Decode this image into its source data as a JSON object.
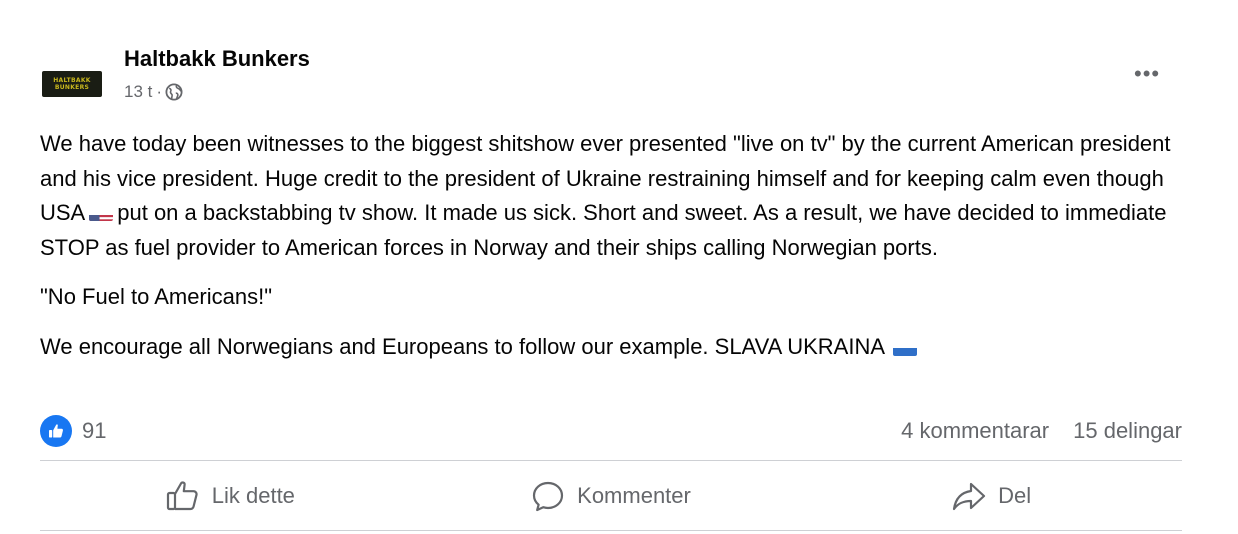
{
  "post": {
    "page_name": "Haltbakk Bunkers",
    "logo_text_line1": "HALTBAKK",
    "logo_text_line2": "BUNKERS",
    "timestamp": "13 t",
    "separator": "·",
    "privacy_icon": "globe-icon",
    "more_label": "•••",
    "body": {
      "p1_part1": "We have today been witnesses to the biggest shitshow ever presented \"live on tv\" by the current American president and his vice president. Huge credit to the president of Ukraine restraining himself and for keeping calm even though USA",
      "p1_flag": "us-flag-emoji",
      "p1_part2": "put on a backstabbing tv show. It made us sick. Short and sweet. As a result, we have decided to immediate STOP as fuel provider to American forces in Norway and their ships calling Norwegian ports.",
      "p2": "\"No Fuel to Americans!\"",
      "p3": "We encourage all Norwegians and Europeans to follow our example. SLAVA UKRAINA",
      "p3_flag": "ukraine-flag-emoji"
    }
  },
  "stats": {
    "reaction_icon": "like-reaction-icon",
    "reaction_count": "91",
    "comments": "4 kommentarar",
    "shares": "15 delingar"
  },
  "actions": {
    "like": "Lik dette",
    "comment": "Kommenter",
    "share": "Del"
  },
  "colors": {
    "text": "#050505",
    "secondary": "#65676b",
    "like_blue": "#1877f2",
    "divider": "#ced0d4",
    "logo_bg": "#1a1d14",
    "logo_text": "#c9b81d"
  }
}
